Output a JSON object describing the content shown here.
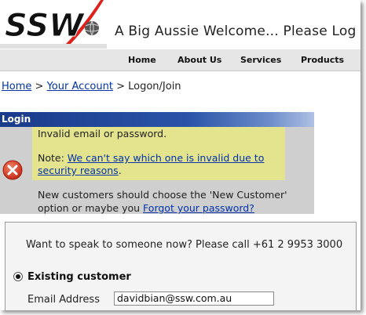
{
  "header": {
    "logo_text": "SSW",
    "welcome": "A Big Aussie Welcome... Please Log"
  },
  "nav": {
    "items": [
      {
        "label": "Home"
      },
      {
        "label": "About Us"
      },
      {
        "label": "Services"
      },
      {
        "label": "Products"
      }
    ]
  },
  "breadcrumb": {
    "home": "Home",
    "sep1": " > ",
    "account": "Your Account",
    "sep2": " > ",
    "current": "Logon/Join"
  },
  "login": {
    "title": "Login"
  },
  "error": {
    "line1": "Invalid email or password.",
    "note_prefix": "Note: ",
    "note_link_line1": "We can't say which one is invalid due to",
    "note_link_line2": "security reasons",
    "note_suffix": ".",
    "new_line1": "New customers should choose the 'New Customer'",
    "new_line2_prefix": "option or maybe you ",
    "forgot_link": "Forgot your password?"
  },
  "form": {
    "call_text": "Want to speak to someone now? Please call +61 2 9953 3000",
    "existing_label": "Existing customer",
    "email_label": "Email Address",
    "email_value": "davidbian@ssw.com.au"
  },
  "colors": {
    "login_bar": "#1a3a8a",
    "highlight": "#e4e38e",
    "link": "#0033aa",
    "error_icon": "#d9341f",
    "logo_swoosh": "#e0201a"
  },
  "icons": {
    "logo_globe": "globe-icon",
    "error": "error-x-icon"
  }
}
